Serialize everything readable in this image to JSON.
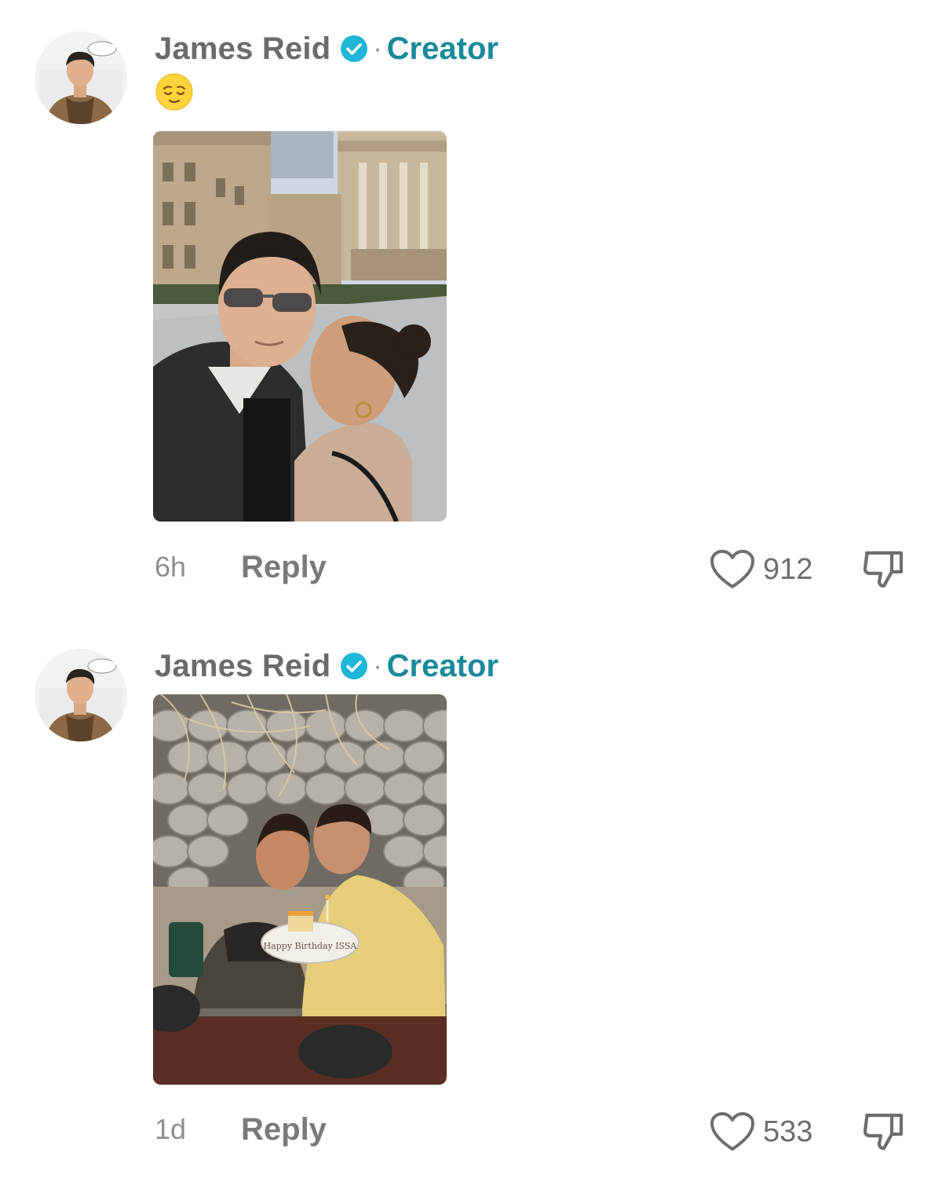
{
  "comments": [
    {
      "username": "James Reid",
      "badge": "Creator",
      "separator": "·",
      "text_emoji": "relieved-face",
      "time": "6h",
      "reply_label": "Reply",
      "likes": "912",
      "photo": "selfie-couple-city-square"
    },
    {
      "username": "James Reid",
      "badge": "Creator",
      "separator": "·",
      "time": "1d",
      "reply_label": "Reply",
      "likes": "533",
      "photo": "couple-birthday-cake-restaurant",
      "photo_caption_plate": "Happy Birthday ISSA"
    }
  ],
  "colors": {
    "username": "#6b6b6b",
    "creator": "#1a8a9a",
    "verified": "#20b6d8",
    "muted": "#8e8e8e"
  }
}
